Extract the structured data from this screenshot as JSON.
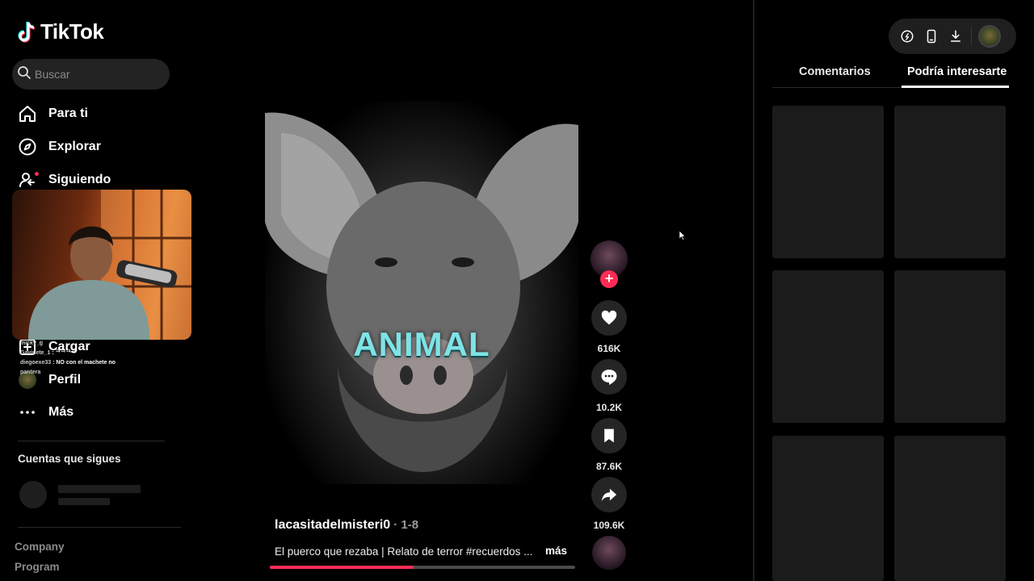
{
  "app": {
    "logo_text": "TikTok",
    "accent": "#fe2c55"
  },
  "search": {
    "placeholder": "Buscar"
  },
  "nav": {
    "for_you": "Para ti",
    "explore": "Explorar",
    "following": "Siguiendo",
    "upload": "Cargar",
    "profile": "Perfil",
    "more": "Más"
  },
  "following_section": {
    "title": "Cuentas que sigues"
  },
  "footer": {
    "company": "Company",
    "program": "Program"
  },
  "stream_chat": [
    {
      "user": "micky_g",
      "text": ""
    },
    {
      "user": "Gavinete_1",
      "text": ": ᄏᄏᄏᄏ"
    },
    {
      "user": "diegoexe33",
      "text": ": NO con el machete no"
    },
    {
      "user": "pantera",
      "text": ""
    }
  ],
  "video": {
    "overlay_text": "ANIMAL",
    "author": "lacasitadelmisteri0",
    "date": "· 1-8",
    "caption": "El puerco que rezaba | Relato de terror #recuerdos ...",
    "more_label": "más",
    "progress_percent": 47
  },
  "actions": {
    "likes": "616K",
    "comments": "10.2K",
    "saves": "87.6K",
    "shares": "109.6K",
    "follow_symbol": "+"
  },
  "panel": {
    "tabs": [
      "Comentarios",
      "Podría interesarte"
    ],
    "active_tab": "Podría interesarte"
  }
}
